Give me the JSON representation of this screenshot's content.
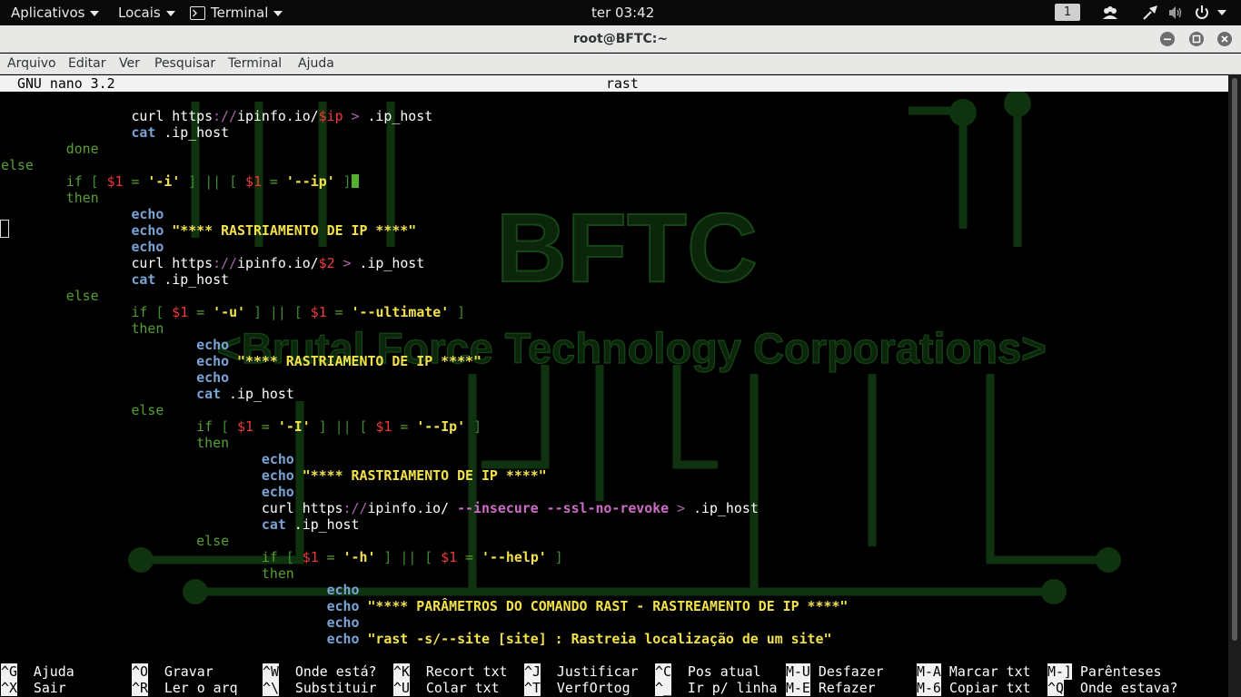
{
  "topbar": {
    "applications": "Aplicativos",
    "places": "Locais",
    "app": "Terminal",
    "clock": "ter 03:42",
    "workspace": "1"
  },
  "window": {
    "title": "root@BFTC:~",
    "menu": [
      "Arquivo",
      "Editar",
      "Ver",
      "Pesquisar",
      "Terminal",
      "Ajuda"
    ]
  },
  "nano": {
    "version": "GNU nano 3.2",
    "filename": "rast"
  },
  "code_lines": [
    [
      [
        "",
        "        curl https"
      ],
      [
        "dm",
        "://"
      ],
      [
        "",
        "ipinfo.io/"
      ],
      [
        "va",
        "$ip"
      ],
      [
        "dm",
        " > "
      ],
      [
        "",
        ".ip_host"
      ]
    ],
    [
      [
        "",
        "        "
      ],
      [
        "cm",
        "cat"
      ],
      [
        "",
        " .ip_host"
      ]
    ],
    [
      [
        "",
        "    "
      ],
      [
        "kw",
        "done"
      ]
    ],
    [
      [
        "kw",
        "else"
      ]
    ],
    [
      [
        "",
        "    "
      ],
      [
        "kw",
        "if"
      ],
      [
        "br",
        " [ "
      ],
      [
        "va",
        "$1"
      ],
      [
        "kw",
        " = "
      ],
      [
        "st",
        "'-i'"
      ],
      [
        "br",
        " ] || [ "
      ],
      [
        "va",
        "$1"
      ],
      [
        "kw",
        " = "
      ],
      [
        "st",
        "'--ip'"
      ],
      [
        "br",
        " ]"
      ],
      [
        "cur",
        ""
      ]
    ],
    [
      [
        "",
        "    "
      ],
      [
        "kw",
        "then"
      ]
    ],
    [
      [
        "",
        "        "
      ],
      [
        "cm",
        "echo"
      ]
    ],
    [
      [
        "",
        "        "
      ],
      [
        "cm",
        "echo"
      ],
      [
        "st",
        " \"**** RASTRIAMENTO DE IP ****\""
      ]
    ],
    [
      [
        "",
        "        "
      ],
      [
        "cm",
        "echo"
      ]
    ],
    [
      [
        "",
        "        curl https"
      ],
      [
        "dm",
        "://"
      ],
      [
        "",
        "ipinfo.io/"
      ],
      [
        "va",
        "$2"
      ],
      [
        "dm",
        " > "
      ],
      [
        "",
        ".ip_host"
      ]
    ],
    [
      [
        "",
        "        "
      ],
      [
        "cm",
        "cat"
      ],
      [
        "",
        " .ip_host"
      ]
    ],
    [
      [
        "",
        "    "
      ],
      [
        "kw",
        "else"
      ]
    ],
    [
      [
        "",
        "        "
      ],
      [
        "kw",
        "if"
      ],
      [
        "br",
        " [ "
      ],
      [
        "va",
        "$1"
      ],
      [
        "kw",
        " = "
      ],
      [
        "st",
        "'-u'"
      ],
      [
        "br",
        " ] || [ "
      ],
      [
        "va",
        "$1"
      ],
      [
        "kw",
        " = "
      ],
      [
        "st",
        "'--ultimate'"
      ],
      [
        "br",
        " ]"
      ]
    ],
    [
      [
        "",
        "        "
      ],
      [
        "kw",
        "then"
      ]
    ],
    [
      [
        "",
        "            "
      ],
      [
        "cm",
        "echo"
      ]
    ],
    [
      [
        "",
        "            "
      ],
      [
        "cm",
        "echo"
      ],
      [
        "st",
        " \"**** RASTRIAMENTO DE IP ****\""
      ]
    ],
    [
      [
        "",
        "            "
      ],
      [
        "cm",
        "echo"
      ]
    ],
    [
      [
        "",
        "            "
      ],
      [
        "cm",
        "cat"
      ],
      [
        "",
        " .ip_host"
      ]
    ],
    [
      [
        "",
        "        "
      ],
      [
        "kw",
        "else"
      ]
    ],
    [
      [
        "",
        "            "
      ],
      [
        "kw",
        "if"
      ],
      [
        "br",
        " [ "
      ],
      [
        "va",
        "$1"
      ],
      [
        "kw",
        " = "
      ],
      [
        "st",
        "'-I'"
      ],
      [
        "br",
        " ] || [ "
      ],
      [
        "va",
        "$1"
      ],
      [
        "kw",
        " = "
      ],
      [
        "st",
        "'--Ip'"
      ],
      [
        "br",
        " ]"
      ]
    ],
    [
      [
        "",
        "            "
      ],
      [
        "kw",
        "then"
      ]
    ],
    [
      [
        "",
        "                "
      ],
      [
        "cm",
        "echo"
      ]
    ],
    [
      [
        "",
        "                "
      ],
      [
        "cm",
        "echo"
      ],
      [
        "st",
        " \"**** RASTRIAMENTO DE IP ****\""
      ]
    ],
    [
      [
        "",
        "                "
      ],
      [
        "cm",
        "echo"
      ]
    ],
    [
      [
        "",
        "                curl https"
      ],
      [
        "dm",
        "://"
      ],
      [
        "",
        "ipinfo.io/ "
      ],
      [
        "op",
        "--insecure --ssl-no-revoke"
      ],
      [
        "dm",
        " > "
      ],
      [
        "",
        ".ip_host"
      ]
    ],
    [
      [
        "",
        "                "
      ],
      [
        "cm",
        "cat"
      ],
      [
        "",
        " .ip_host"
      ]
    ],
    [
      [
        "",
        "            "
      ],
      [
        "kw",
        "else"
      ]
    ],
    [
      [
        "",
        "                "
      ],
      [
        "kw",
        "if"
      ],
      [
        "br",
        " [ "
      ],
      [
        "va",
        "$1"
      ],
      [
        "kw",
        " = "
      ],
      [
        "st",
        "'-h'"
      ],
      [
        "br",
        " ] || [ "
      ],
      [
        "va",
        "$1"
      ],
      [
        "kw",
        " = "
      ],
      [
        "st",
        "'--help'"
      ],
      [
        "br",
        " ]"
      ]
    ],
    [
      [
        "",
        "                "
      ],
      [
        "kw",
        "then"
      ]
    ],
    [
      [
        "",
        "                    "
      ],
      [
        "cm",
        "echo"
      ]
    ],
    [
      [
        "",
        "                    "
      ],
      [
        "cm",
        "echo"
      ],
      [
        "st",
        " \"**** PARÂMETROS DO COMANDO RAST - RASTREAMENTO DE IP ****\""
      ]
    ],
    [
      [
        "",
        "                    "
      ],
      [
        "cm",
        "echo"
      ]
    ],
    [
      [
        "",
        "                    "
      ],
      [
        "cm",
        "echo"
      ],
      [
        "st",
        " \"rast -s/--site [site] : Rastreia localização de um site\""
      ]
    ]
  ],
  "shortcuts": [
    [
      {
        "key": "^G",
        "label": "Ajuda"
      },
      {
        "key": "^X",
        "label": "Sair"
      }
    ],
    [
      {
        "key": "^O",
        "label": "Gravar"
      },
      {
        "key": "^R",
        "label": "Ler o arq"
      }
    ],
    [
      {
        "key": "^W",
        "label": "Onde está?"
      },
      {
        "key": "^\\",
        "label": "Substituir"
      }
    ],
    [
      {
        "key": "^K",
        "label": "Recort txt"
      },
      {
        "key": "^U",
        "label": "Colar txt"
      }
    ],
    [
      {
        "key": "^J",
        "label": "Justificar"
      },
      {
        "key": "^T",
        "label": "VerfOrtog"
      }
    ],
    [
      {
        "key": "^C",
        "label": "Pos atual"
      },
      {
        "key": "^_",
        "label": "Ir p/ linha"
      }
    ],
    [
      {
        "key": "M-U",
        "label": "Desfazer"
      },
      {
        "key": "M-E",
        "label": "Refazer"
      }
    ],
    [
      {
        "key": "M-A",
        "label": "Marcar txt"
      },
      {
        "key": "M-6",
        "label": "Copiar txt"
      }
    ],
    [
      {
        "key": "M-]",
        "label": "Parênteses"
      },
      {
        "key": "^Q",
        "label": "Onde estava?"
      }
    ]
  ],
  "wallpaper": {
    "logo_text": "BFTC",
    "tagline": "<Brutal Force Technology Corporations>",
    "color": "#0d2a0d"
  },
  "colors": {
    "keyword": "#55a030",
    "command": "#7aa3d6",
    "variable": "#ef3a3a",
    "string": "#f2e14a",
    "option": "#cc6cc6"
  },
  "icons": [
    "applications-arrow",
    "terminal-icon",
    "workspace-indicator",
    "people-icon",
    "network-icon",
    "volume-icon",
    "power-icon",
    "minimize-icon",
    "maximize-icon",
    "close-icon"
  ]
}
